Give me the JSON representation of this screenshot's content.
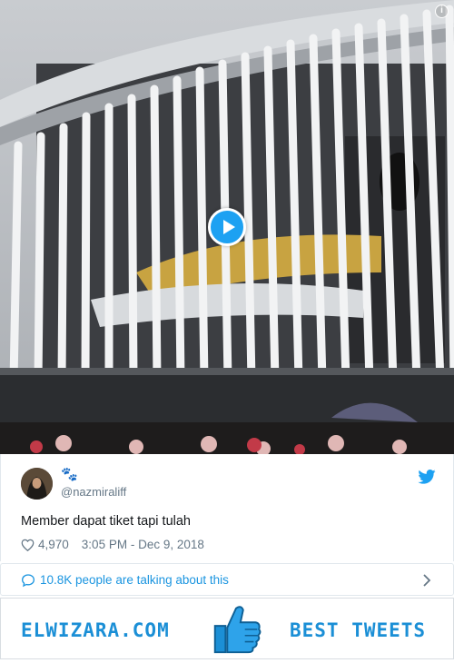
{
  "video": {
    "info_icon": "info-icon",
    "play_icon": "play-icon"
  },
  "tweet": {
    "emoji": "🐾",
    "handle": "@nazmiraliff",
    "text": "Member dapat tiket tapi tulah",
    "likes": "4,970",
    "timestamp": "3:05 PM - Dec 9, 2018",
    "bird_icon": "twitter-bird-icon",
    "heart_icon": "heart-icon"
  },
  "conversation": {
    "text": "10.8K people are talking about this",
    "bubble_icon": "speech-bubble-icon",
    "chevron_icon": "chevron-right-icon"
  },
  "banner": {
    "left_text": "ELWIZARA.COM",
    "right_text": "BEST TWEETS",
    "thumb_icon": "thumbs-up-icon"
  },
  "colors": {
    "accent": "#1da1f2",
    "link": "#1b95e0",
    "brand": "#1b8fd6",
    "muted": "#657786"
  }
}
